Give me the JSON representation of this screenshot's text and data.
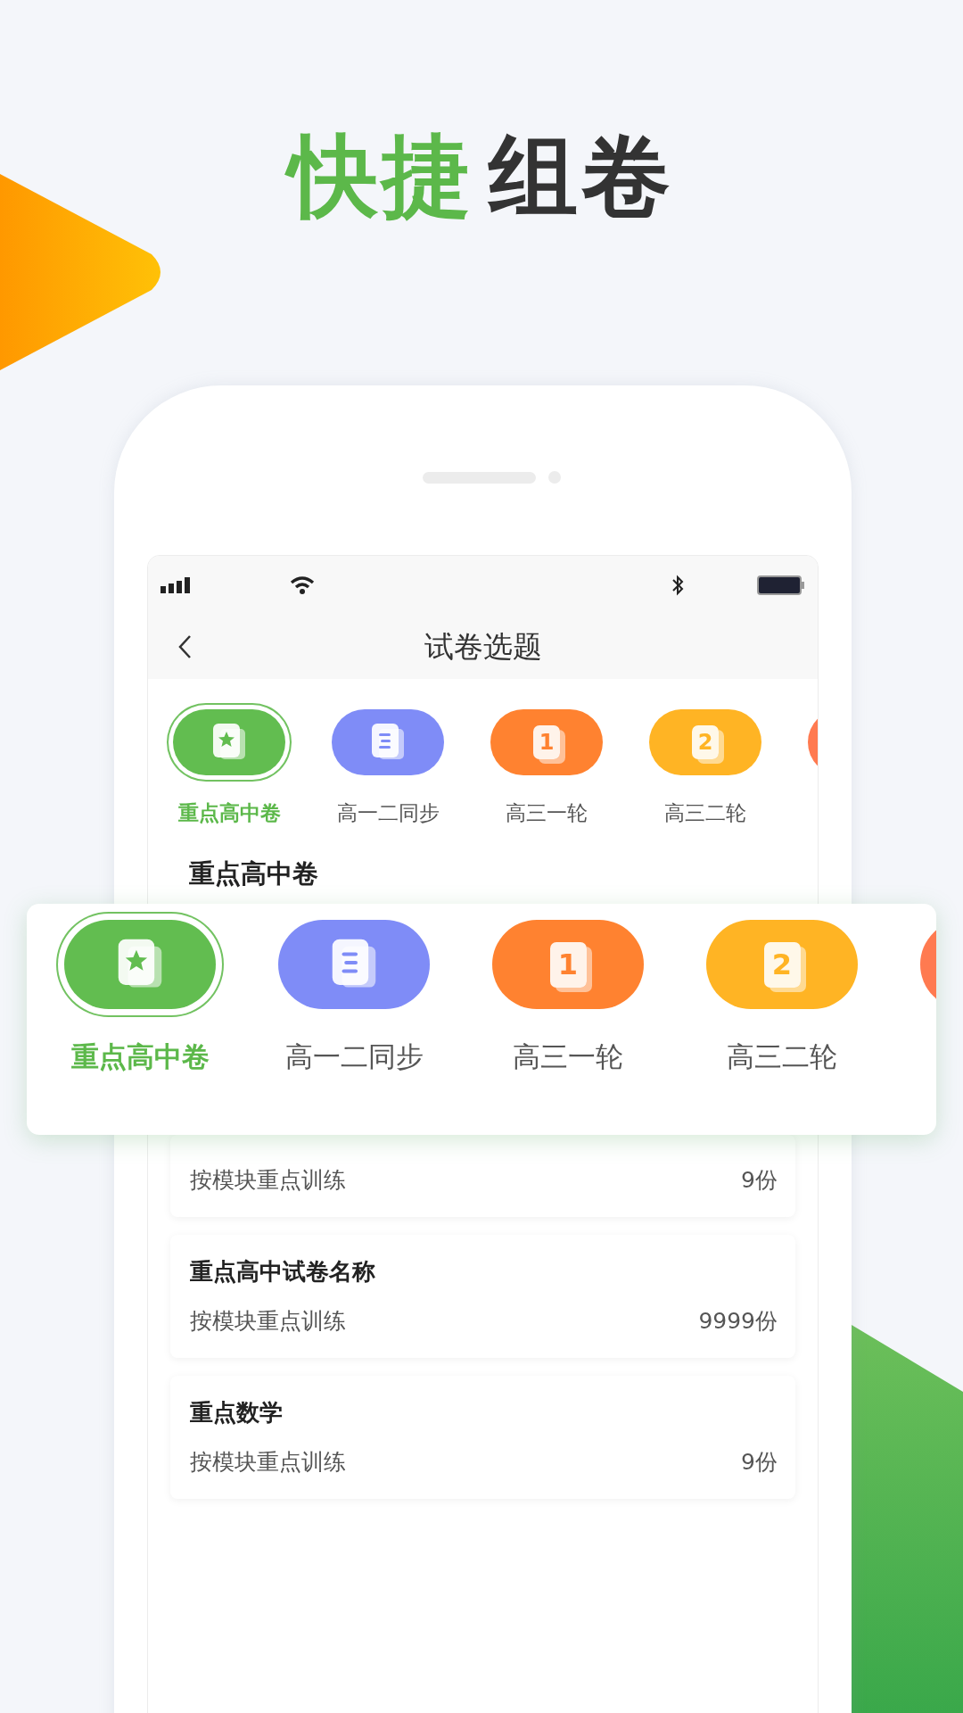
{
  "headline": {
    "highlight": "快捷",
    "rest": "组卷"
  },
  "nav": {
    "title": "试卷选题"
  },
  "categories": [
    {
      "label": "重点高中卷",
      "kind": "star",
      "selected": true,
      "color": "#62bd50"
    },
    {
      "label": "高一二同步",
      "kind": "lines",
      "selected": false,
      "color": "#7f8cf7"
    },
    {
      "label": "高三一轮",
      "kind": "number",
      "badge": "1",
      "selected": false,
      "color": "#ff8230"
    },
    {
      "label": "高三二轮",
      "kind": "number",
      "badge": "2",
      "selected": false,
      "color": "#ffb424"
    },
    {
      "kind": "blank",
      "selected": false,
      "color": "#ff7a50"
    }
  ],
  "section": {
    "title": "重点高中卷"
  },
  "zoom_card": {
    "categories": [
      {
        "label": "重点高中卷",
        "kind": "star",
        "selected": true,
        "color": "#62bd50"
      },
      {
        "label": "高一二同步",
        "kind": "lines",
        "selected": false,
        "color": "#7f8cf7"
      },
      {
        "label": "高三一轮",
        "kind": "number",
        "badge": "1",
        "selected": false,
        "color": "#ff8230"
      },
      {
        "label": "高三二轮",
        "kind": "number",
        "badge": "2",
        "selected": false,
        "color": "#ffb424"
      },
      {
        "kind": "blank",
        "selected": false,
        "color": "#ff7a50"
      }
    ]
  },
  "papers": [
    {
      "description": "按模块重点训练",
      "count": "9份"
    },
    {
      "title": "重点高中试卷名称",
      "description": "按模块重点训练",
      "count": "9999份"
    },
    {
      "title": "重点数学",
      "description": "按模块重点训练",
      "count": "9份"
    }
  ]
}
